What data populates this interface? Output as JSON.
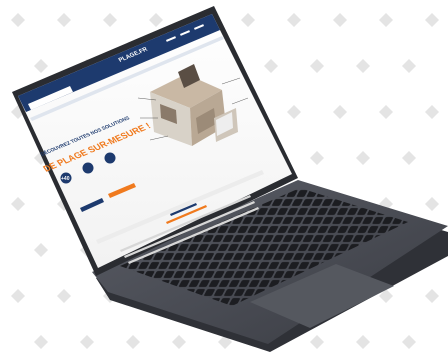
{
  "site": {
    "logo_text": "PLAGE.FR",
    "nav_items": [
      "",
      "",
      "",
      "",
      "",
      ""
    ],
    "hero": {
      "line1": "DÉCOUVREZ TOUTES NOS SOLUTIONS",
      "line2": "DE PLAGE SUR-MESURE !",
      "badge": "+40",
      "cta_primary": "",
      "cta_secondary": ""
    },
    "section_title": ""
  },
  "colors": {
    "header_navy": "#1d3a6e",
    "accent_orange": "#f07a1e",
    "diamond_grey": "#e3e3e3",
    "laptop_body": "#4a4d55",
    "laptop_dark": "#2b2d33"
  },
  "icons": [
    "diamond-pattern",
    "house-cutaway-illustration",
    "circle-icons"
  ]
}
